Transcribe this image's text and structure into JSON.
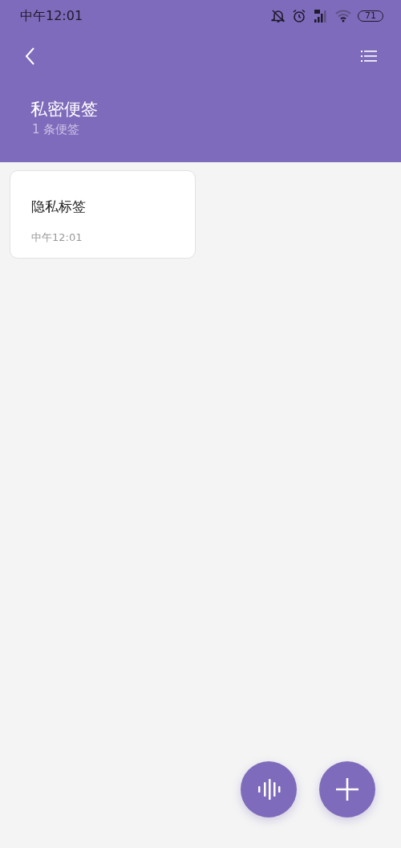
{
  "status_bar": {
    "time": "中午12:01",
    "battery": "71"
  },
  "header": {
    "title": "私密便签",
    "subtitle": "1 条便签"
  },
  "notes": [
    {
      "title": "隐私标签",
      "time": "中午12:01"
    }
  ]
}
